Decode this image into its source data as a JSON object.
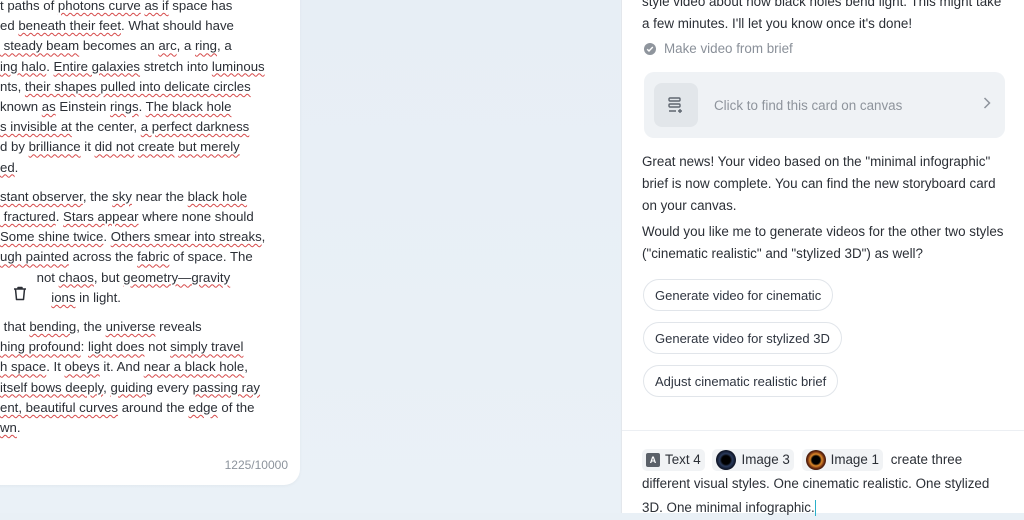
{
  "canvas": {
    "text_card": {
      "paragraphs": [
        [
          {
            "t": "t paths of "
          },
          {
            "t": "photons curve",
            "s": 1
          },
          {
            "t": " "
          },
          {
            "t": "as if",
            "s": 1
          },
          {
            "t": " space has"
          },
          {
            "br": 1
          },
          {
            "t": "ed "
          },
          {
            "t": "beneath their feet",
            "s": 1
          },
          {
            "t": ". What should have"
          },
          {
            "br": 1
          },
          {
            "t": " steady beam",
            "s": 1
          },
          {
            "t": " becomes an "
          },
          {
            "t": "arc",
            "s": 1
          },
          {
            "t": ", a "
          },
          {
            "t": "ring",
            "s": 1
          },
          {
            "t": ", a"
          },
          {
            "br": 1
          },
          {
            "t": "ing halo",
            "s": 1
          },
          {
            "t": ". "
          },
          {
            "t": "Entire galaxies",
            "s": 1
          },
          {
            "t": " stretch into "
          },
          {
            "t": "luminous",
            "s": 1
          },
          {
            "br": 1
          },
          {
            "t": "nts, "
          },
          {
            "t": "their shapes pulled into delicate circles",
            "s": 1
          },
          {
            "br": 1
          },
          {
            "t": "known "
          },
          {
            "t": "as",
            "s": 1
          },
          {
            "t": " Einstein "
          },
          {
            "t": "rings",
            "s": 1
          },
          {
            "t": ". "
          },
          {
            "t": "The black hole",
            "s": 1
          },
          {
            "br": 1
          },
          {
            "t": "s invisible at",
            "s": 1
          },
          {
            "t": " the center, "
          },
          {
            "t": "a perfect darkness",
            "s": 1
          },
          {
            "br": 1
          },
          {
            "t": "d by "
          },
          {
            "t": "brilliance",
            "s": 1
          },
          {
            "t": " it "
          },
          {
            "t": "did not",
            "s": 1
          },
          {
            "t": " "
          },
          {
            "t": "create",
            "s": 1
          },
          {
            "t": " "
          },
          {
            "t": "but merely",
            "s": 1
          },
          {
            "br": 1
          },
          {
            "t": "ed",
            "s": 1
          },
          {
            "t": "."
          }
        ],
        [
          {
            "t": "stant observer",
            "s": 1
          },
          {
            "t": ", the "
          },
          {
            "t": "sky",
            "s": 1
          },
          {
            "t": " near the "
          },
          {
            "t": "black hole",
            "s": 1
          },
          {
            "br": 1
          },
          {
            "t": " fractured",
            "s": 1
          },
          {
            "t": ". "
          },
          {
            "t": "Stars appear",
            "s": 1
          },
          {
            "t": " where none should"
          },
          {
            "br": 1
          },
          {
            "t": "Some shine twice",
            "s": 1
          },
          {
            "t": ". "
          },
          {
            "t": "Others smear into streaks",
            "s": 1
          },
          {
            "t": ","
          },
          {
            "br": 1
          },
          {
            "t": "ugh painted",
            "s": 1
          },
          {
            "t": " across the "
          },
          {
            "t": "fabric",
            "s": 1
          },
          {
            "t": " of space. The"
          },
          {
            "br": 1
          },
          {
            "t": "          not "
          },
          {
            "t": "chaos",
            "s": 1
          },
          {
            "t": ", but "
          },
          {
            "t": "geometry—gravity",
            "s": 1
          },
          {
            "br": 1
          },
          {
            "t": "              "
          },
          {
            "t": "ions",
            "s": 1
          },
          {
            "t": " in light."
          }
        ],
        [
          {
            "t": " that "
          },
          {
            "t": "bending",
            "s": 1
          },
          {
            "t": ", the "
          },
          {
            "t": "universe",
            "s": 1
          },
          {
            "t": " reveals"
          },
          {
            "br": 1
          },
          {
            "t": "hing profound",
            "s": 1
          },
          {
            "t": ": "
          },
          {
            "t": "light does",
            "s": 1
          },
          {
            "t": " not "
          },
          {
            "t": "simply travel",
            "s": 1
          },
          {
            "br": 1
          },
          {
            "t": "h space",
            "s": 1
          },
          {
            "t": ". It "
          },
          {
            "t": "obeys",
            "s": 1
          },
          {
            "t": " it. And "
          },
          {
            "t": "near a black hole",
            "s": 1
          },
          {
            "t": ","
          },
          {
            "br": 1
          },
          {
            "t": "itself bows deeply",
            "s": 1
          },
          {
            "t": ", "
          },
          {
            "t": "guiding",
            "s": 1
          },
          {
            "t": " every "
          },
          {
            "t": "passing ray",
            "s": 1
          },
          {
            "br": 1
          },
          {
            "t": "ent, beautiful curves",
            "s": 1
          },
          {
            "t": " around the "
          },
          {
            "t": "edge",
            "s": 1
          },
          {
            "t": " of the"
          },
          {
            "br": 1
          },
          {
            "t": "wn",
            "s": 1
          },
          {
            "t": "."
          }
        ]
      ],
      "char_count": "1225/10000"
    }
  },
  "chat": {
    "top_message": "style video about how black holes bend light. This might take a few minutes. I'll let you know once it's done!",
    "step_label": "Make video from brief",
    "find_card_label": "Click to find this card on canvas",
    "completion_message": "Great news! Your video based on the \"minimal infographic\" brief is now complete. You can find the new storyboard card on your canvas.",
    "followup_message": "Would you like me to generate videos for the other two styles (\"cinematic realistic\" and \"stylized 3D\") as well?",
    "suggestions": [
      "Generate video for cinematic",
      "Generate video for stylized 3D",
      "Adjust cinematic realistic brief"
    ],
    "composer": {
      "tags": [
        {
          "label": "Text 4",
          "icon": "text-icon"
        },
        {
          "label": "Image 3",
          "icon": "image-thumbnail"
        },
        {
          "label": "Image 1",
          "icon": "image-thumbnail"
        }
      ],
      "text": "create three different visual styles. One cinematic realistic. One stylized 3D. One minimal infographic."
    }
  }
}
